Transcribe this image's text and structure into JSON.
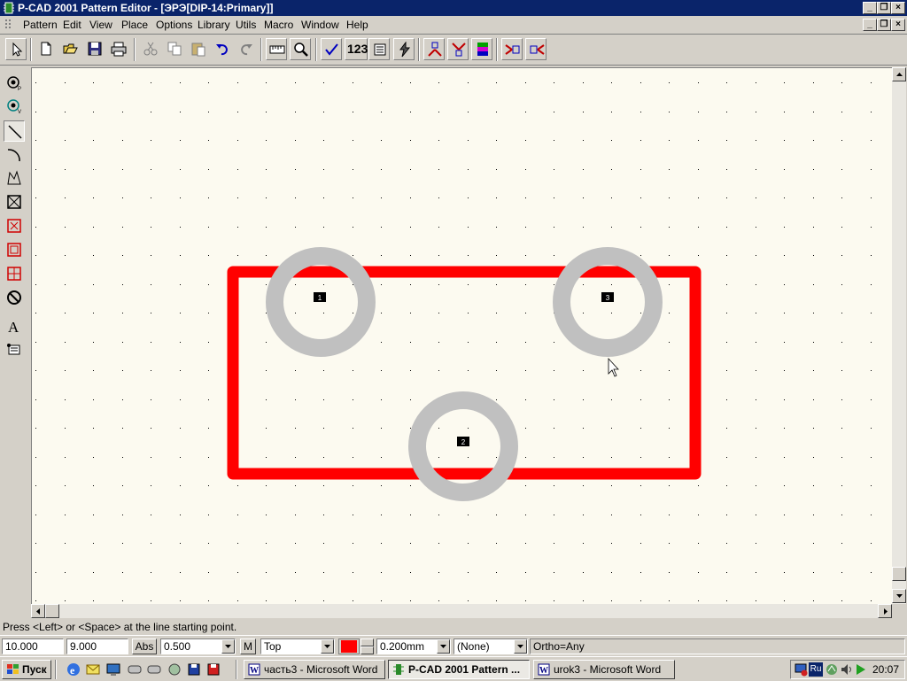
{
  "window": {
    "title": "P-CAD 2001 Pattern Editor - [ЭРЭ[DIP-14:Primary]]"
  },
  "menu": {
    "items": [
      {
        "label": "Pattern",
        "u": "P"
      },
      {
        "label": "Edit",
        "u": "E"
      },
      {
        "label": "View",
        "u": "V"
      },
      {
        "label": "Place",
        "u": "a"
      },
      {
        "label": "Options",
        "u": "O"
      },
      {
        "label": "Library",
        "u": "L"
      },
      {
        "label": "Utils",
        "u": "U"
      },
      {
        "label": "Macro",
        "u": "M"
      },
      {
        "label": "Window",
        "u": "W"
      },
      {
        "label": "Help",
        "u": "H"
      }
    ]
  },
  "toolbar": {
    "renumber_label": "123",
    "icons": [
      "select-icon",
      "new-icon",
      "open-icon",
      "save-icon",
      "print-icon",
      "cut-icon",
      "copy-icon",
      "paste-icon",
      "undo-icon",
      "redo-icon",
      "measure-icon",
      "zoom-icon",
      "drc-check-icon",
      "renumber-icon",
      "pattern-wizard-icon",
      "explode-icon",
      "pad-style-icon",
      "via-style-icon",
      "layers-icon",
      "rotate-icon",
      "flip-icon"
    ]
  },
  "left_tools": [
    "place-pad-icon",
    "place-via-icon",
    "place-line-icon",
    "place-arc-icon",
    "place-polygon-icon",
    "place-copper-pour-icon",
    "place-cutout-icon",
    "place-keepout-icon",
    "place-plane-icon",
    "place-no-connect-icon",
    "place-text-icon",
    "place-attribute-icon"
  ],
  "pads": [
    {
      "number": "1"
    },
    {
      "number": "2"
    },
    {
      "number": "3"
    }
  ],
  "colors": {
    "outline": "#ff0000",
    "pad": "#c0c0c0",
    "canvas": "#fcfaf0",
    "grid_dot": "#000000",
    "title_bar": "#0a246a"
  },
  "status": {
    "prompt": "Press <Left> or <Space> at the line starting point.",
    "x": "10.000",
    "y": "9.000",
    "abs_label": "Abs",
    "grid": "0.500",
    "macro_label": "M",
    "layer": "Top",
    "line_width": "0.200mm",
    "net": "(None)",
    "ortho": "Ortho=Any"
  },
  "taskbar": {
    "start_label": "Пуск",
    "tasks": [
      {
        "label": "часть3 - Microsoft Word",
        "active": false
      },
      {
        "label": "P-CAD 2001 Pattern ...",
        "active": true
      },
      {
        "label": "urok3 - Microsoft Word",
        "active": false
      }
    ],
    "lang": "Ru",
    "clock": "20:07"
  }
}
